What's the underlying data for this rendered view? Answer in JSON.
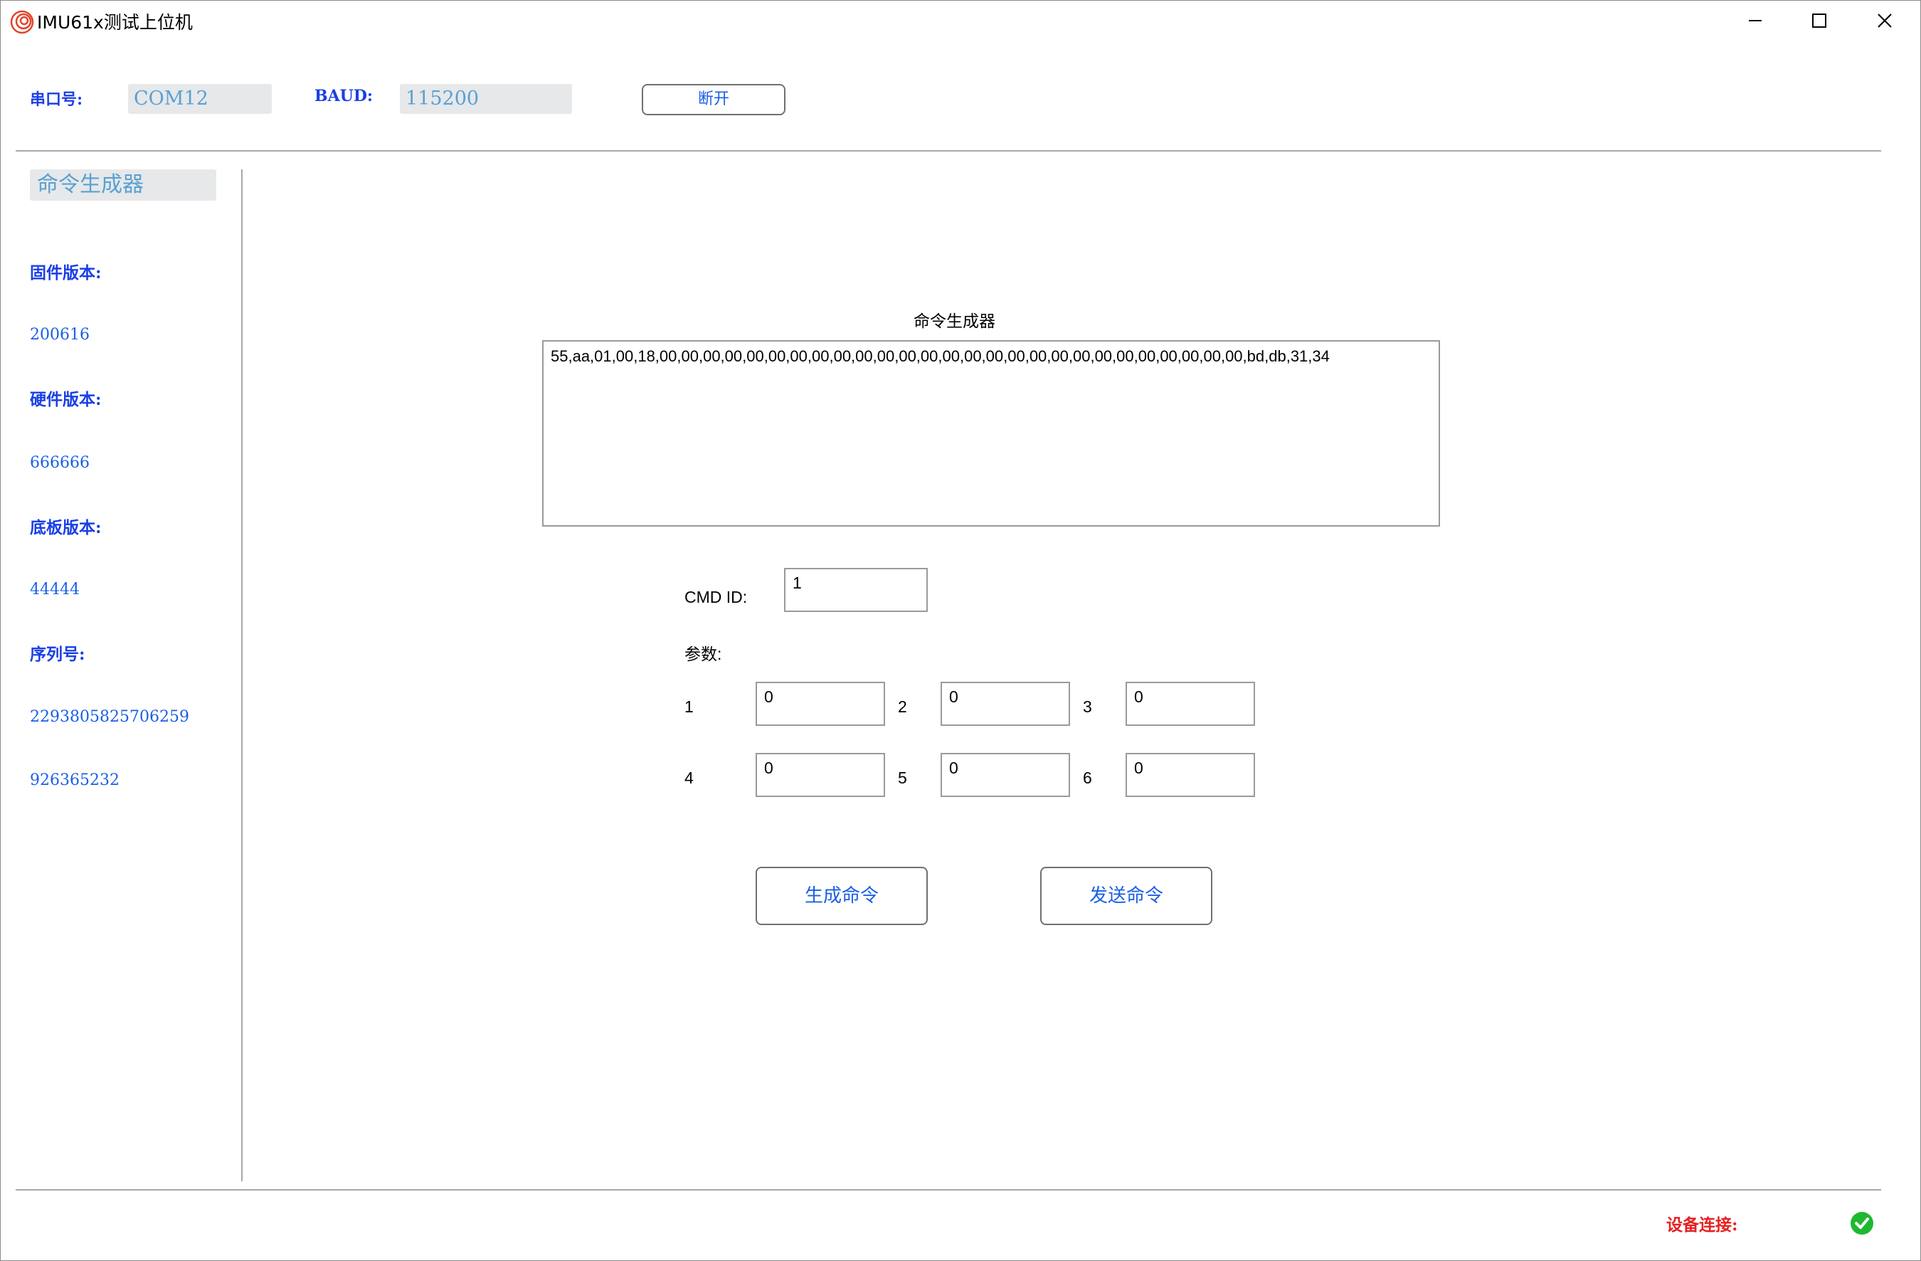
{
  "window": {
    "title": "IMU61x测试上位机",
    "icon": "app-logo-icon",
    "controls": [
      "minimize-icon",
      "maximize-icon",
      "close-icon"
    ]
  },
  "connection": {
    "port_label": "串口号:",
    "port_value": "COM12",
    "baud_label": "BAUD:",
    "baud_value": "115200",
    "disconnect_label": "断开"
  },
  "sidebar": {
    "active_item": "命令生成器",
    "firmware_label": "固件版本:",
    "firmware_value": "200616",
    "hardware_label": "硬件版本:",
    "hardware_value": "666666",
    "board_label": "底板版本:",
    "board_value": "44444",
    "serial_label": "序列号:",
    "serial_value": "2293805825706259",
    "extra_value": "926365232"
  },
  "generator": {
    "title": "命令生成器",
    "output": "55,aa,01,00,18,00,00,00,00,00,00,00,00,00,00,00,00,00,00,00,00,00,00,00,00,00,00,00,00,00,00,00,bd,db,31,34",
    "cmd_id_label": "CMD ID:",
    "cmd_id_value": "1",
    "params_label": "参数:",
    "params": [
      {
        "index": "1",
        "value": "0"
      },
      {
        "index": "2",
        "value": "0"
      },
      {
        "index": "3",
        "value": "0"
      },
      {
        "index": "4",
        "value": "0"
      },
      {
        "index": "5",
        "value": "0"
      },
      {
        "index": "6",
        "value": "0"
      }
    ],
    "generate_label": "生成命令",
    "send_label": "发送命令"
  },
  "status": {
    "device_label": "设备连接:",
    "icon": "check-circle-icon",
    "color": "#1fb832"
  },
  "colors": {
    "label_blue": "#1a3fe6",
    "value_blue": "#1a5fe6",
    "field_text": "#5aa0d2",
    "field_bg": "#e6e8ea",
    "status_red": "#e62020"
  }
}
